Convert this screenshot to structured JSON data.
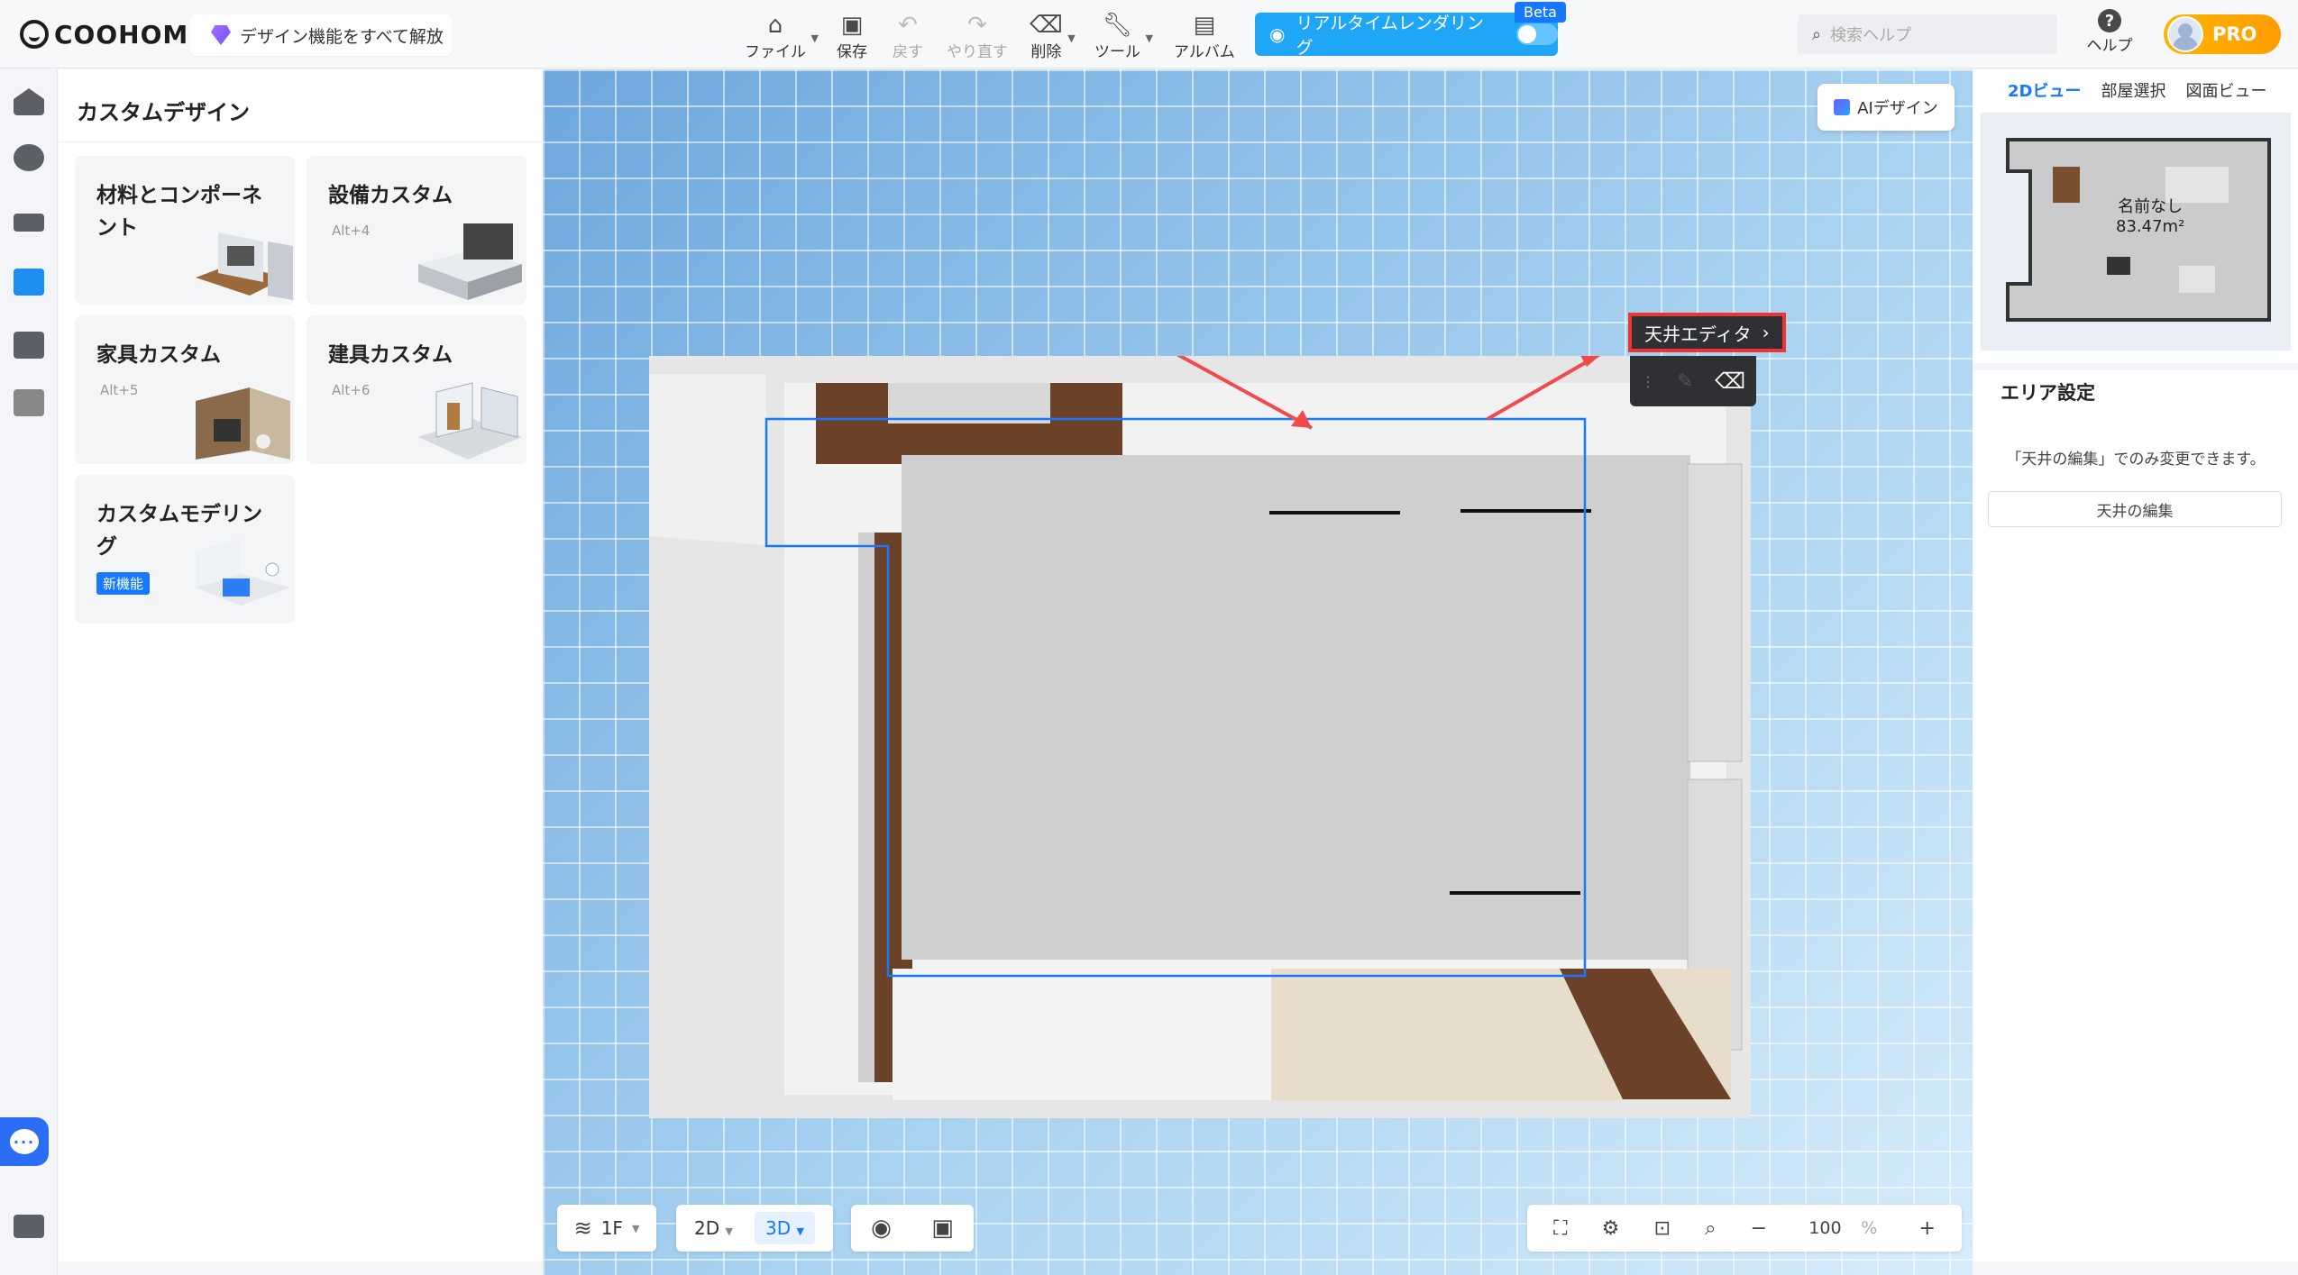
{
  "header": {
    "logo": "COOHOM",
    "unlock_label": "デザイン機能をすべて解放",
    "tools": [
      {
        "label": "ファイル"
      },
      {
        "label": "保存"
      },
      {
        "label": "戻す"
      },
      {
        "label": "やり直す"
      },
      {
        "label": "削除"
      },
      {
        "label": "ツール"
      },
      {
        "label": "アルバム"
      }
    ],
    "render_label": "リアルタイムレンダリング",
    "beta": "Beta",
    "search_placeholder": "検索ヘルプ",
    "help_label": "ヘルプ",
    "pro_label": "PRO"
  },
  "left_panel": {
    "title": "カスタムデザイン",
    "cards": [
      {
        "title": "材料とコンポーネント",
        "shortcut": ""
      },
      {
        "title": "設備カスタム",
        "shortcut": "Alt+4"
      },
      {
        "title": "家具カスタム",
        "shortcut": "Alt+5"
      },
      {
        "title": "建具カスタム",
        "shortcut": "Alt+6"
      },
      {
        "title": "カスタムモデリング",
        "badge": "新機能"
      }
    ]
  },
  "canvas": {
    "ai_label": "AIデザイン",
    "ceiling_editor_label": "天井エディタ",
    "floor": "1F",
    "view_2d": "2D",
    "view_3d": "3D",
    "zoom": "100",
    "zoom_unit": "%"
  },
  "right_panel": {
    "tabs": [
      "2Dビュー",
      "部屋選択",
      "図面ビュー"
    ],
    "minimap_room_name": "名前なし",
    "minimap_room_area": "83.47m²",
    "area_title": "エリア設定",
    "area_note": "「天井の編集」でのみ変更できます。",
    "ceiling_edit_button": "天井の編集"
  },
  "colors": {
    "accent": "#1677ff",
    "render": "#1fa6f7",
    "highlight": "#e33333",
    "canvas": "#8fc3ea"
  }
}
